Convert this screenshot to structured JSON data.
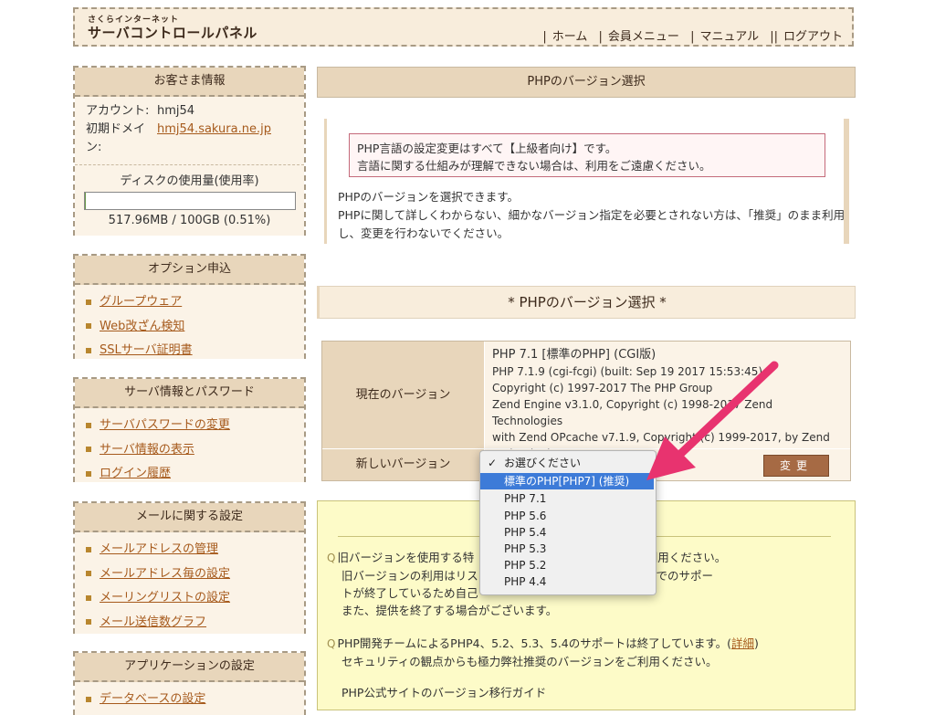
{
  "header": {
    "brand_small": "さくらインターネット",
    "brand_big": "サーバコントロールパネル",
    "nav": [
      "ホーム",
      "会員メニュー",
      "マニュアル",
      "ログアウト"
    ]
  },
  "customer": {
    "title": "お客さま情報",
    "account_label": "アカウント:",
    "account_value": "hmj54",
    "domain_label": "初期ドメイン:",
    "domain_value": "hmj54.sakura.ne.jp",
    "disk_title": "ディスクの使用量(使用率)",
    "disk_usage_text": "517.96MB / 100GB (0.51%)",
    "disk_usage_fraction": 0.0051
  },
  "options": {
    "title": "オプション申込",
    "items": [
      "グループウェア",
      "Web改ざん検知",
      "SSLサーバ証明書"
    ]
  },
  "server_info": {
    "title": "サーバ情報とパスワード",
    "items": [
      "サーバパスワードの変更",
      "サーバ情報の表示",
      "ログイン履歴"
    ]
  },
  "mail": {
    "title": "メールに関する設定",
    "items": [
      "メールアドレスの管理",
      "メールアドレス毎の設定",
      "メーリングリストの設定",
      "メール送信数グラフ"
    ]
  },
  "apps": {
    "title": "アプリケーションの設定",
    "items": [
      "データベースの設定"
    ]
  },
  "main": {
    "title": "PHPのバージョン選択",
    "warning_line1": "PHP言語の設定変更はすべて【上級者向け】です。",
    "warning_line2": "言語に関する仕組みが理解できない場合は、利用をご遠慮ください。",
    "intro_line1": "PHPのバージョンを選択できます。",
    "intro_line2": "PHPに関して詳しくわからない、細かなバージョン指定を必要とされない方は、「推奨」のまま利用し、変更を行わないでください。",
    "section_title": "* PHPのバージョン選択 *",
    "current_label": "現在のバージョン",
    "current_lines": [
      "PHP 7.1 [標準のPHP] (CGI版)",
      "PHP 7.1.9 (cgi-fcgi) (built: Sep 19 2017 15:53:45)",
      "Copyright (c) 1997-2017 The PHP Group",
      "Zend Engine v3.1.0, Copyright (c) 1998-2017 Zend Technologies",
      "with Zend OPcache v7.1.9, Copyright (c) 1999-2017, by Zend",
      "Technologies"
    ],
    "new_label": "新しいバージョン",
    "change_button": "変更"
  },
  "dropdown": {
    "options": [
      "お選びください",
      "標準のPHP[PHP7] (推奨)",
      "PHP 7.1",
      "PHP 5.6",
      "PHP 5.4",
      "PHP 5.3",
      "PHP 5.2",
      "PHP 4.4"
    ],
    "checked_index": 0,
    "highlighted_index": 1
  },
  "notes": {
    "note1_line1": "旧バージョンを使用する特",
    "note1_line1b": "ジョンをご利用ください。",
    "note1_line2": "旧バージョンの利用はリス",
    "note1_line2b": "ますが、公式でのサポー",
    "note1_line3": "トが終了しているため自己",
    "note1_line4": "また、提供を終了する場合がございます。",
    "note2_line1": "PHP開発チームによるPHP4、5.2、5.3、5.4のサポートは終了しています。(",
    "note2_link": "詳細",
    "note2_close": ")",
    "note2_line2": "セキュリティの観点からも極力弊社推奨のバージョンをご利用ください。",
    "guide_line": "PHP公式サイトのバージョン移行ガイド"
  },
  "colors": {
    "panel_bg": "#e8d6bb",
    "link": "#a65a1c",
    "highlight": "#3d7bd8",
    "arrow": "#e8336f"
  }
}
